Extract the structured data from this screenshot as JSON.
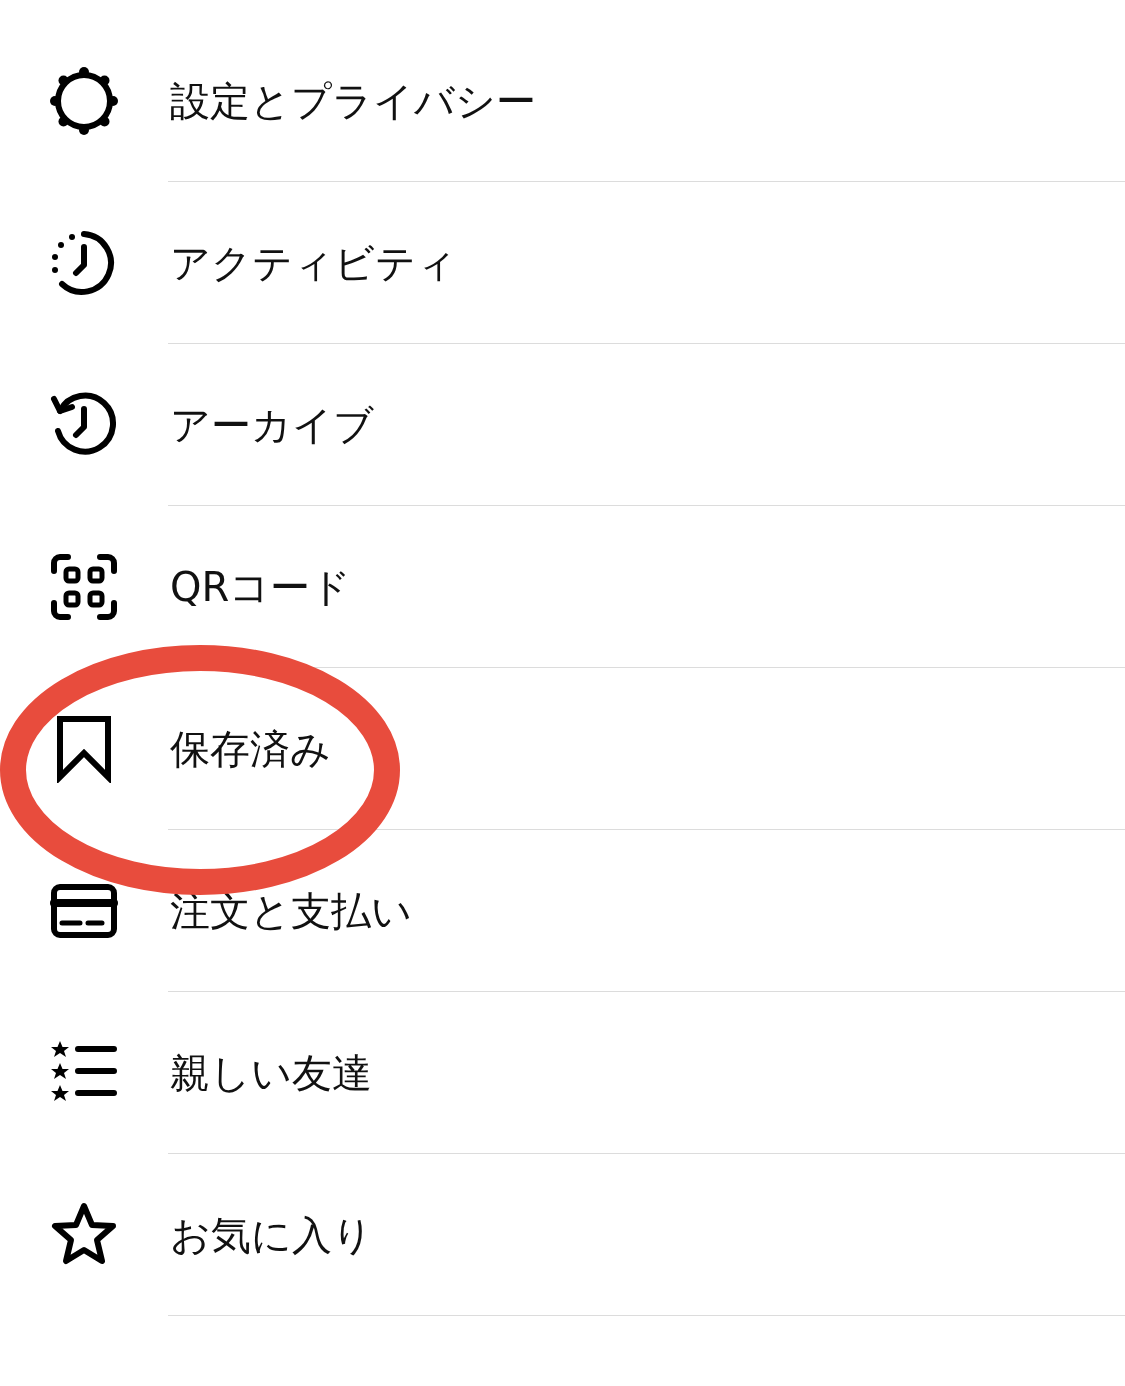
{
  "menu": {
    "items": [
      {
        "kind": "gear",
        "label": "設定とプライバシー",
        "circled": false
      },
      {
        "kind": "activity",
        "label": "アクティビティ",
        "circled": false
      },
      {
        "kind": "archive",
        "label": "アーカイブ",
        "circled": false
      },
      {
        "kind": "qr",
        "label": "QRコード",
        "circled": false
      },
      {
        "kind": "bookmark",
        "label": "保存済み",
        "circled": true
      },
      {
        "kind": "card",
        "label": "注文と支払い",
        "circled": false
      },
      {
        "kind": "starlist",
        "label": "親しい友達",
        "circled": false
      },
      {
        "kind": "star",
        "label": "お気に入り",
        "circled": false
      }
    ]
  },
  "annotation": {
    "color": "#e84c3d"
  }
}
